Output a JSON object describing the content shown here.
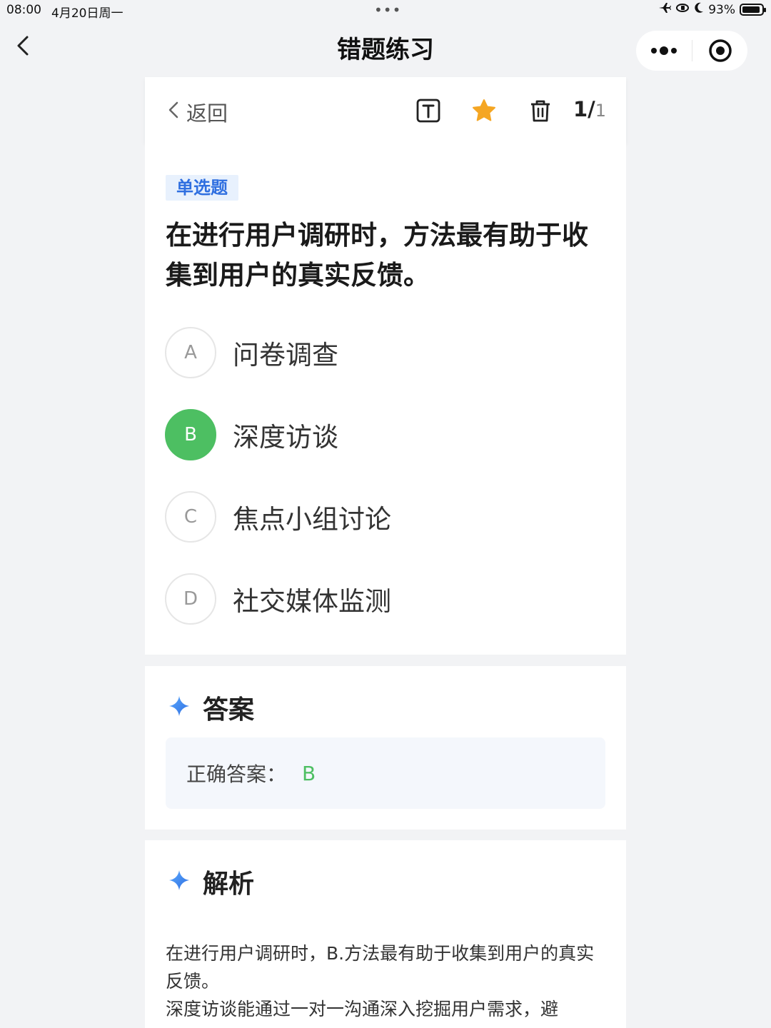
{
  "status_bar": {
    "time": "08:00",
    "date": "4月20日周一",
    "battery": "93%",
    "battery_level": 0.93
  },
  "nav": {
    "title": "错题练习"
  },
  "toolbar": {
    "back_label": "返回",
    "counter_current": "1/",
    "counter_total": "1"
  },
  "question": {
    "type": "单选题",
    "text": "在进行用户调研时，方法最有助于收集到用户的真实反馈。",
    "options": [
      {
        "letter": "A",
        "text": "问卷调查"
      },
      {
        "letter": "B",
        "text": "深度访谈"
      },
      {
        "letter": "C",
        "text": "焦点小组讨论"
      },
      {
        "letter": "D",
        "text": "社交媒体监测"
      }
    ]
  },
  "answer": {
    "title": "答案",
    "label": "正确答案：",
    "value": "B"
  },
  "analysis": {
    "title": "解析",
    "text": "在进行用户调研时，B.方法最有助于收集到用户的真实反馈。\n深度访谈能通过一对一沟通深入挖掘用户需求，避"
  },
  "colors": {
    "correct": "#4dbf62",
    "accent_blue": "#2f6fe0",
    "star": "#f5a623"
  }
}
